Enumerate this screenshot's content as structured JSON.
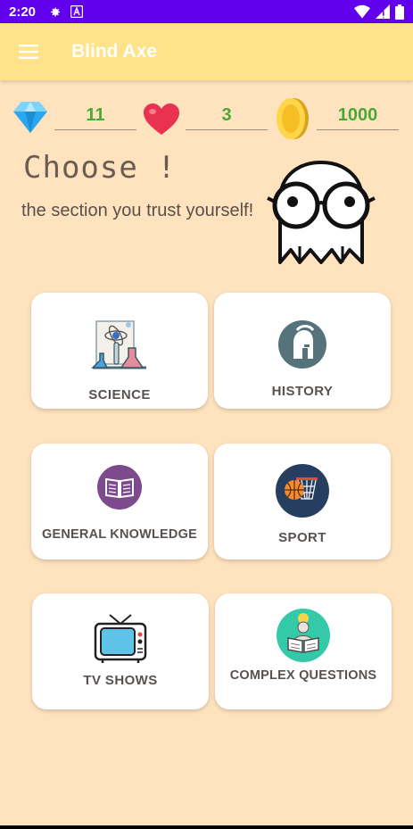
{
  "status_bar": {
    "time": "2:20",
    "icons": [
      "gear-icon",
      "a-badge-icon",
      "wifi-icon",
      "signal-icon",
      "battery-icon"
    ]
  },
  "app_bar": {
    "title": "Blind Axe",
    "menu_icon": "hamburger-menu-icon"
  },
  "stats": {
    "gems": "11",
    "lives": "3",
    "coins": "1000"
  },
  "header": {
    "title": "Choose !",
    "subtitle": "the section you trust yourself!"
  },
  "categories": [
    {
      "label": "SCIENCE",
      "icon": "science-lab-icon"
    },
    {
      "label": "HISTORY",
      "icon": "spartan-helmet-icon"
    },
    {
      "label": "GENERAL KNOWLEDGE",
      "icon": "book-icon"
    },
    {
      "label": "SPORT",
      "icon": "basketball-icon"
    },
    {
      "label": "TV SHOWS",
      "icon": "tv-icon"
    },
    {
      "label": "COMPLEX QUESTIONS",
      "icon": "reader-icon"
    }
  ],
  "colors": {
    "status_bar": "#6200EE",
    "app_bar": "#FFE38A",
    "background": "#FFE3BF",
    "stat_value": "#4CA836",
    "card_label": "#57524F"
  }
}
